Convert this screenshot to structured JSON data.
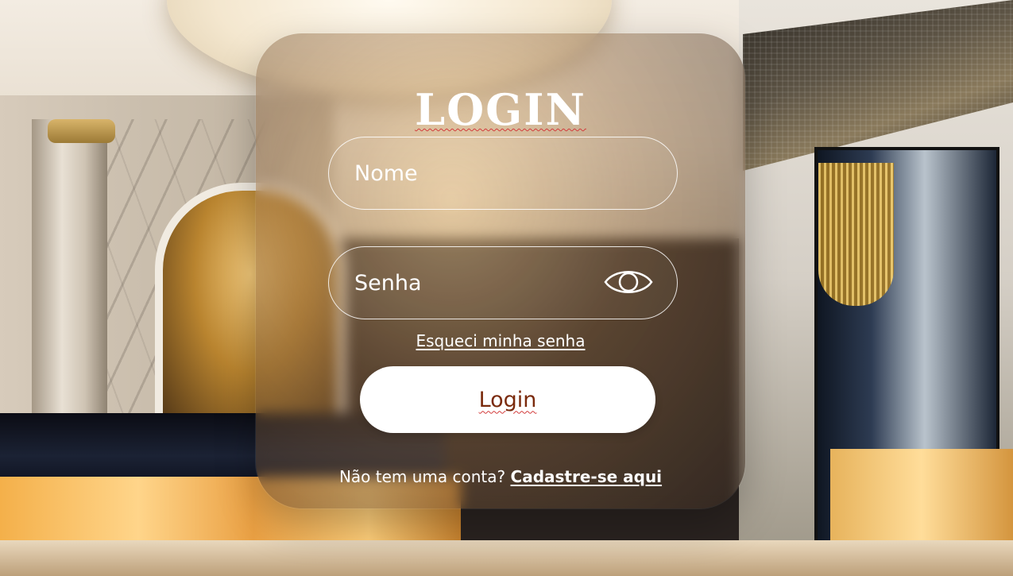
{
  "login": {
    "title": "LOGIN",
    "name_placeholder": "Nome",
    "password_placeholder": "Senha",
    "show_password_icon": "eye-icon",
    "forgot_password": "Esqueci minha senha",
    "login_button": "Login",
    "no_account_text": "Não tem uma conta?",
    "signup_link": "Cadastre-se aqui"
  },
  "colors": {
    "card_text": "#ffffff",
    "button_background": "#ffffff",
    "button_text": "#7a2a0c"
  }
}
